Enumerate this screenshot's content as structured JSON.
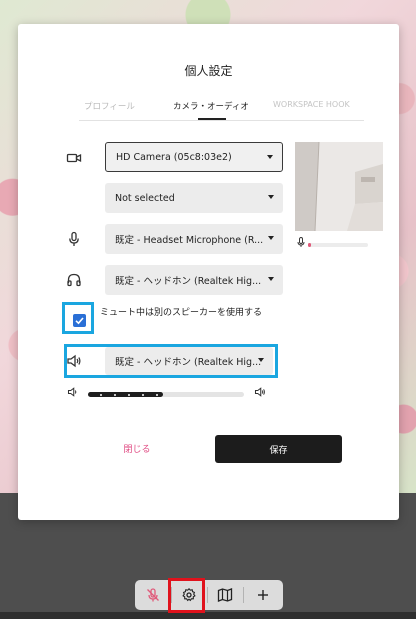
{
  "modal": {
    "title": "個人設定",
    "tabs": [
      {
        "label": "プロフィール",
        "active": false
      },
      {
        "label": "カメラ・オーディオ",
        "active": true
      },
      {
        "label": "WORKSPACE HOOK",
        "active": false
      }
    ],
    "camera": {
      "icon": "video-camera-icon",
      "selected": "HD Camera (05c8:03e2)"
    },
    "second_select": {
      "selected": "Not selected"
    },
    "microphone": {
      "icon": "microphone-icon",
      "selected": "既定 - Headset Microphone (R..."
    },
    "headphones": {
      "icon": "headphones-icon",
      "selected": "既定 - ヘッドホン (Realtek Hig..."
    },
    "mute_option": {
      "checked": true,
      "label": "ミュート中は別のスピーカーを使用する"
    },
    "speaker": {
      "icon": "speaker-icon",
      "selected": "既定 - ヘッドホン (Realtek Hig..."
    },
    "volume": {
      "level_percent": 48
    },
    "close_label": "閉じる",
    "save_label": "保存"
  },
  "toolbar": {
    "items": [
      "microphone-muted-icon",
      "settings-gear-icon",
      "map-icon",
      "plus-icon"
    ]
  },
  "colors": {
    "accent_highlight": "#1aa6e0",
    "red_highlight": "#e0121c",
    "close_text": "#e04a82",
    "save_bg": "#1c1c1c"
  }
}
